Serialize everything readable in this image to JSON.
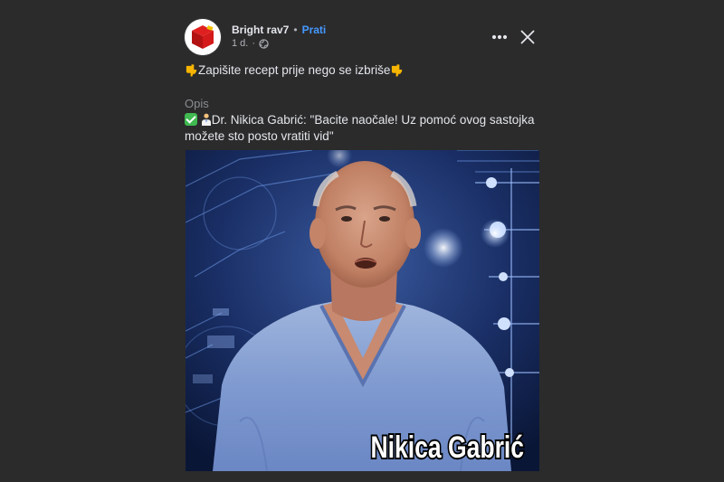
{
  "post": {
    "author": "Bright rav7",
    "separator": "•",
    "follow_label": "Prati",
    "time": "1 d.",
    "time_separator": "·",
    "privacy_icon": "globe-icon",
    "more_icon": "more-horizontal-icon",
    "close_icon": "close-icon",
    "caption": "Zapišite recept prije nego se izbriše",
    "caption_emoji": "backhand-index-pointing-down",
    "description_label": "Opis",
    "description_text": "Dr. Nikica Gabrić: \"Bacite naočale! Uz pomoć ovog sastojka možete sto posto vratiti vid\"",
    "description_emojis": [
      "check-mark-button",
      "doctor"
    ],
    "media_overlay_text": "Nikica Gabrić"
  },
  "colors": {
    "background": "#2b2b2c",
    "text_primary": "#e4e6eb",
    "text_secondary": "#b0b3b8",
    "link": "#4599ff",
    "scrub_top": "#a9b9d6"
  }
}
